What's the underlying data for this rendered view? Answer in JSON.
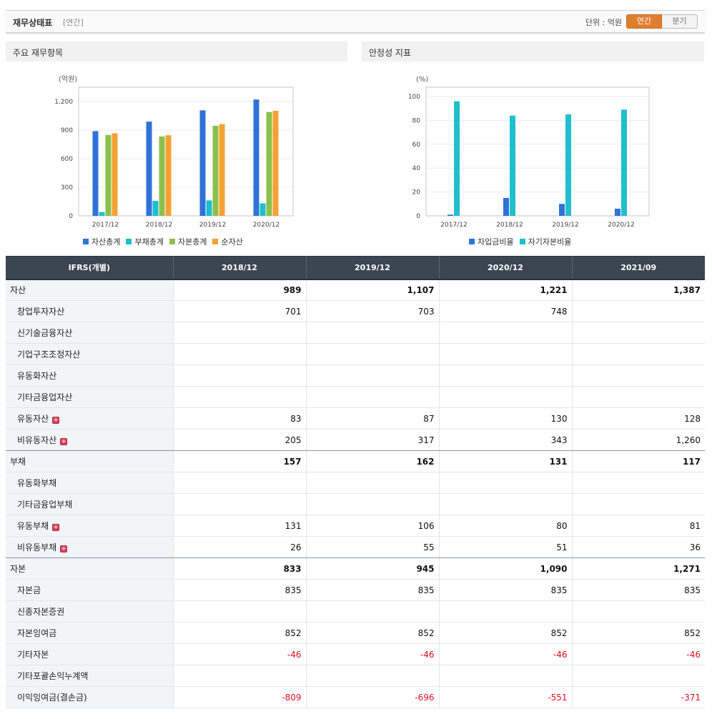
{
  "header": {
    "title": "재무상태표",
    "period": "[연간]",
    "unit": "단위 : 억원",
    "tab_annual": "연간",
    "tab_quarter": "분기"
  },
  "colors": {
    "asset": "#2f72d8",
    "debt": "#1fbfce",
    "capital": "#8dc04a",
    "net": "#f4a234",
    "ratio1": "#2f72d8",
    "ratio2": "#1fbfce"
  },
  "chart_data": [
    {
      "type": "bar",
      "title": "주요 재무항목",
      "unit": "(억원)",
      "categories": [
        "2017/12",
        "2018/12",
        "2019/12",
        "2020/12"
      ],
      "series": [
        {
          "name": "자산총계",
          "values": [
            889,
            989,
            1107,
            1221
          ]
        },
        {
          "name": "부채총계",
          "values": [
            40,
            157,
            162,
            131
          ]
        },
        {
          "name": "자본총계",
          "values": [
            849,
            833,
            945,
            1090
          ]
        },
        {
          "name": "순자산",
          "values": [
            866,
            846,
            962,
            1102
          ]
        }
      ],
      "yticks": [
        "0",
        "300",
        "600",
        "900",
        "1,200"
      ],
      "ylim": [
        0,
        1200
      ]
    },
    {
      "type": "bar",
      "title": "안정성 지표",
      "unit": "(%)",
      "categories": [
        "2017/12",
        "2018/12",
        "2019/12",
        "2020/12"
      ],
      "series": [
        {
          "name": "차입금비율",
          "values": [
            1,
            15,
            10,
            6
          ]
        },
        {
          "name": "자기자본비율",
          "values": [
            96,
            84,
            85,
            89
          ]
        }
      ],
      "yticks": [
        "0",
        "20",
        "40",
        "60",
        "80",
        "100"
      ],
      "ylim": [
        0,
        100
      ]
    }
  ],
  "table": {
    "head": [
      "IFRS(개별)",
      "2018/12",
      "2019/12",
      "2020/12",
      "2021/09"
    ],
    "rows": [
      {
        "label": "자산",
        "main": true,
        "values": [
          "989",
          "1,107",
          "1,221",
          "1,387"
        ]
      },
      {
        "label": "창업투자자산",
        "values": [
          "701",
          "703",
          "748",
          ""
        ]
      },
      {
        "label": "신기술금융자산",
        "values": [
          "",
          "",
          "",
          ""
        ]
      },
      {
        "label": "기업구조조정자산",
        "values": [
          "",
          "",
          "",
          ""
        ]
      },
      {
        "label": "유동화자산",
        "values": [
          "",
          "",
          "",
          ""
        ]
      },
      {
        "label": "기타금융업자산",
        "values": [
          "",
          "",
          "",
          ""
        ]
      },
      {
        "label": "유동자산",
        "expand": true,
        "values": [
          "83",
          "87",
          "130",
          "128"
        ]
      },
      {
        "label": "비유동자산",
        "expand": true,
        "sep": true,
        "values": [
          "205",
          "317",
          "343",
          "1,260"
        ]
      },
      {
        "label": "부채",
        "main": true,
        "values": [
          "157",
          "162",
          "131",
          "117"
        ]
      },
      {
        "label": "유동화부채",
        "values": [
          "",
          "",
          "",
          ""
        ]
      },
      {
        "label": "기타금융업부채",
        "values": [
          "",
          "",
          "",
          ""
        ]
      },
      {
        "label": "유동부채",
        "expand": true,
        "values": [
          "131",
          "106",
          "80",
          "81"
        ]
      },
      {
        "label": "비유동부채",
        "expand": true,
        "sep": true,
        "values": [
          "26",
          "55",
          "51",
          "36"
        ]
      },
      {
        "label": "자본",
        "main": true,
        "values": [
          "833",
          "945",
          "1,090",
          "1,271"
        ]
      },
      {
        "label": "자본금",
        "values": [
          "835",
          "835",
          "835",
          "835"
        ]
      },
      {
        "label": "신종자본증권",
        "values": [
          "",
          "",
          "",
          ""
        ]
      },
      {
        "label": "자본잉여금",
        "values": [
          "852",
          "852",
          "852",
          "852"
        ]
      },
      {
        "label": "기타자본",
        "values": [
          "-46",
          "-46",
          "-46",
          "-46"
        ]
      },
      {
        "label": "기타포괄손익누계액",
        "values": [
          "",
          "",
          "",
          ""
        ]
      },
      {
        "label": "이익잉여금(결손금)",
        "values": [
          "-809",
          "-696",
          "-551",
          "-371"
        ]
      }
    ]
  }
}
